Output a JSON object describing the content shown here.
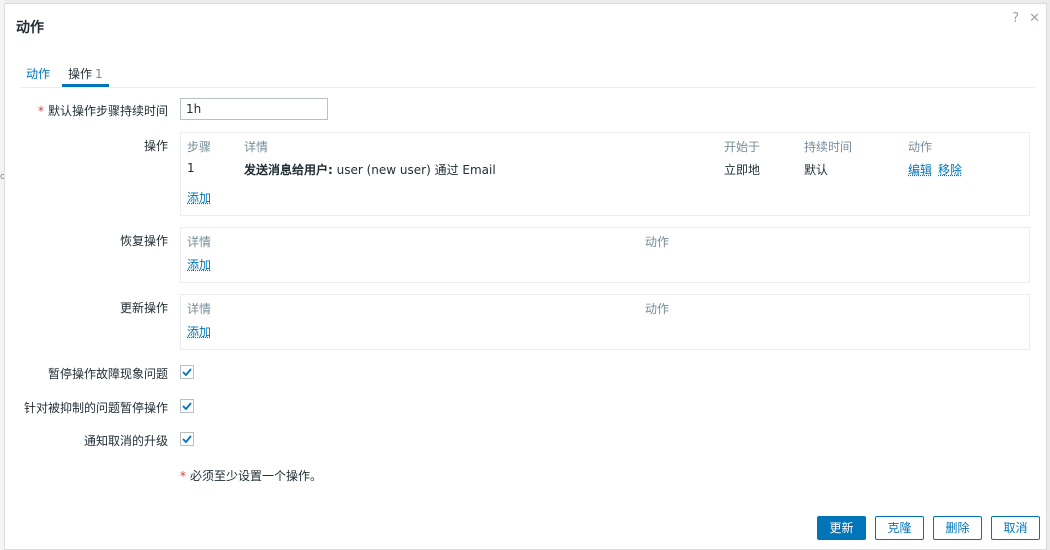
{
  "background": {
    "tick": "o"
  },
  "dialog": {
    "title": "动作",
    "help_icon": "?",
    "close_icon": "✕"
  },
  "tabs": [
    {
      "label": "动作",
      "count": ""
    },
    {
      "label": "操作",
      "count": "1"
    }
  ],
  "form": {
    "duration": {
      "label": "默认操作步骤持续时间",
      "required_mark": "*",
      "value": "1h"
    },
    "operations": {
      "label": "操作",
      "headers": [
        "步骤",
        "详情",
        "开始于",
        "持续时间",
        "动作"
      ],
      "rows": [
        {
          "step": "1",
          "detail_bold": "发送消息给用户:",
          "detail_rest": " user (new user) 通过 Email",
          "start": "立即地",
          "duration": "默认",
          "edit": "编辑",
          "remove": "移除"
        }
      ],
      "add": "添加"
    },
    "recovery": {
      "label": "恢复操作",
      "headers": [
        "详情",
        "动作"
      ],
      "add": "添加"
    },
    "update": {
      "label": "更新操作",
      "headers": [
        "详情",
        "动作"
      ],
      "add": "添加"
    },
    "pause_suppressed": {
      "label": "暂停操作故障现象问题",
      "checked": true
    },
    "pause_symptoms": {
      "label": "针对被抑制的问题暂停操作",
      "checked": true
    },
    "notify_cancel": {
      "label": "通知取消的升级",
      "checked": true
    },
    "note": {
      "mark": "*",
      "text": "必须至少设置一个操作。"
    }
  },
  "buttons": {
    "update": "更新",
    "clone": "克隆",
    "delete": "删除",
    "cancel": "取消"
  },
  "colors": {
    "accent": "#0275b8",
    "required": "#e33734",
    "muted": "#768d99"
  }
}
